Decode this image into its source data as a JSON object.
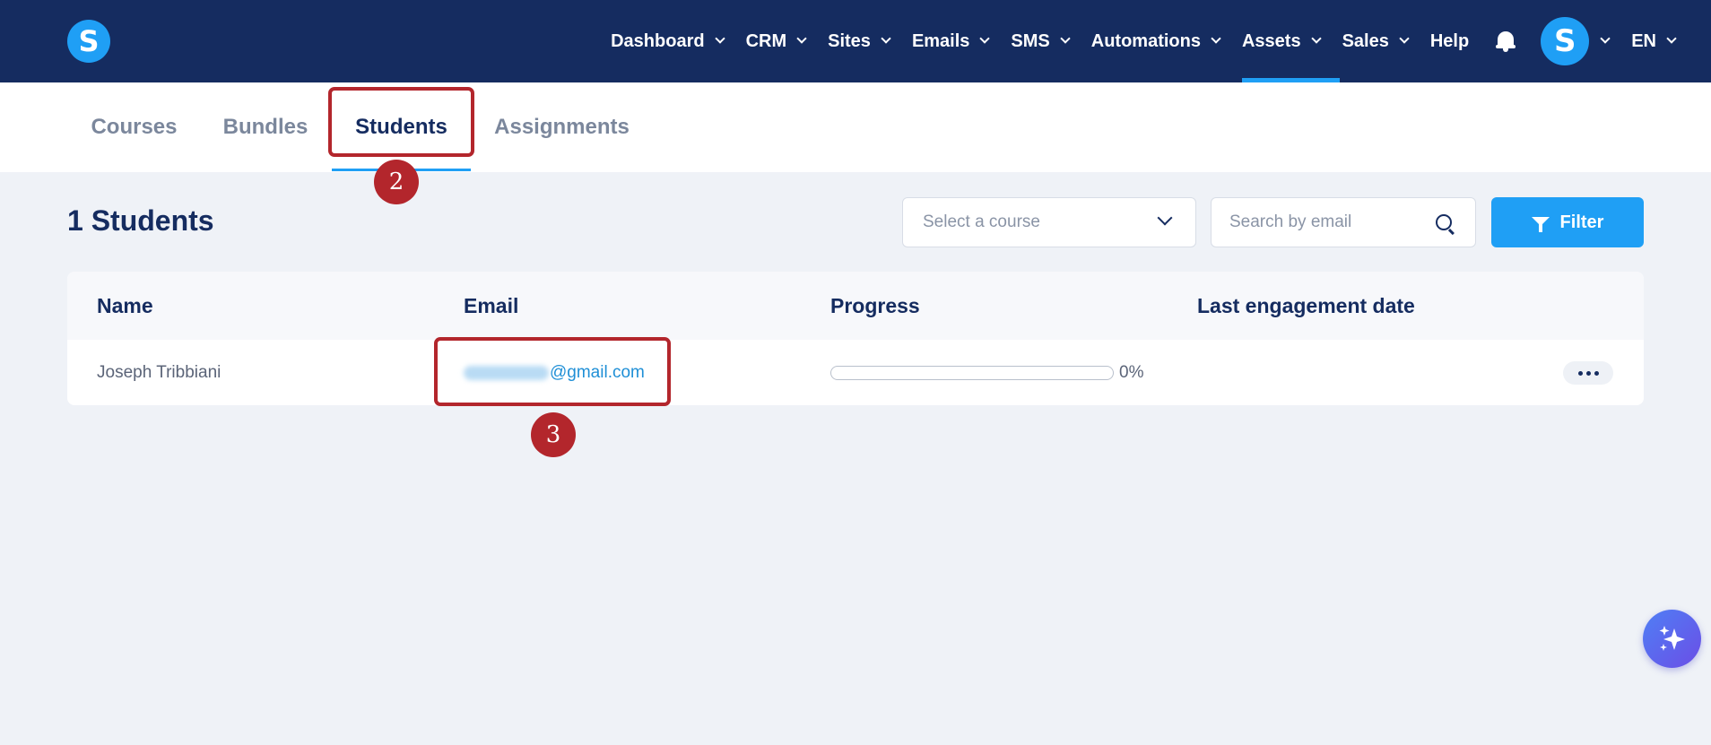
{
  "nav": {
    "logo": "S",
    "items": [
      {
        "label": "Dashboard",
        "dropdown": true
      },
      {
        "label": "CRM",
        "dropdown": true
      },
      {
        "label": "Sites",
        "dropdown": true
      },
      {
        "label": "Emails",
        "dropdown": true
      },
      {
        "label": "SMS",
        "dropdown": true
      },
      {
        "label": "Automations",
        "dropdown": true
      },
      {
        "label": "Assets",
        "dropdown": true,
        "active": true
      },
      {
        "label": "Sales",
        "dropdown": true
      },
      {
        "label": "Help",
        "dropdown": false
      }
    ],
    "notification_icon": "bell-icon",
    "avatar_initial": "S",
    "language": "EN"
  },
  "tabs": [
    {
      "label": "Courses",
      "active": false
    },
    {
      "label": "Bundles",
      "active": false
    },
    {
      "label": "Students",
      "active": true
    },
    {
      "label": "Assignments",
      "active": false
    }
  ],
  "annotations": {
    "step_tab": "2",
    "step_email": "3"
  },
  "page": {
    "title": "1 Students",
    "course_select_placeholder": "Select a course",
    "search_placeholder": "Search by email",
    "filter_label": "Filter"
  },
  "table": {
    "columns": [
      "Name",
      "Email",
      "Progress",
      "Last engagement date"
    ],
    "rows": [
      {
        "name": "Joseph Tribbiani",
        "email_domain": "@gmail.com",
        "progress": 0,
        "progress_text": "0%",
        "last_engagement": ""
      }
    ]
  },
  "colors": {
    "nav_bg": "#152c60",
    "accent": "#1f9ff5",
    "annotation": "#b3262c",
    "page_bg": "#eff2f7"
  }
}
